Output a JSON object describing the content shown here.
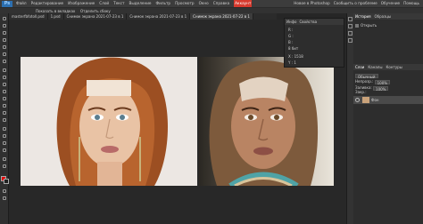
{
  "app": {
    "logo": "Ps"
  },
  "menu": {
    "items": [
      "Файл",
      "Редактирование",
      "Изображение",
      "Слой",
      "Текст",
      "Выделение",
      "Фильтр",
      "Просмотр",
      "Окно",
      "Справка",
      "Аккаунт"
    ],
    "active_index": 10
  },
  "menubar_right": [
    "Новое в Photoshop",
    "Сообщить о проблеме",
    "Обучение",
    "Помощь"
  ],
  "options": {
    "label1": "Показать в вкладках",
    "label2": "Отделить сбоку"
  },
  "tabs": [
    {
      "label": "masterfbfotoll.psd"
    },
    {
      "label": "1.psd"
    },
    {
      "label": "Снимок экрана 2021-07-23 в 1"
    },
    {
      "label": "Снимок экрана 2021-07-23 в 1"
    },
    {
      "label": "Снимок экрана 2021-07-22 в 1"
    }
  ],
  "properties": {
    "tabs": [
      "Инфо",
      "Свойства"
    ],
    "rows": [
      {
        "label": "R :"
      },
      {
        "label": "G :"
      },
      {
        "label": "B :"
      },
      {
        "label": "8 бит"
      },
      {
        "label": "X :",
        "value": "1518"
      },
      {
        "label": "Y :",
        "value": "1"
      }
    ]
  },
  "panel": {
    "tabs": [
      "История",
      "Образцы"
    ],
    "history_item": "Открыть",
    "layers_tabs": [
      "Слои",
      "Каналы",
      "Контуры"
    ],
    "blend_mode": "Обычный",
    "opacity_label": "Непрозр.:",
    "opacity_value": "100%",
    "fill_label": "Заливка:",
    "fill_value": "100%",
    "lock_label": "Закр.:",
    "layer_name": "Фон"
  },
  "colors": {
    "accent": "#d73a2e",
    "foreground_swatch": "#e00000",
    "background_swatch": "#222222"
  }
}
